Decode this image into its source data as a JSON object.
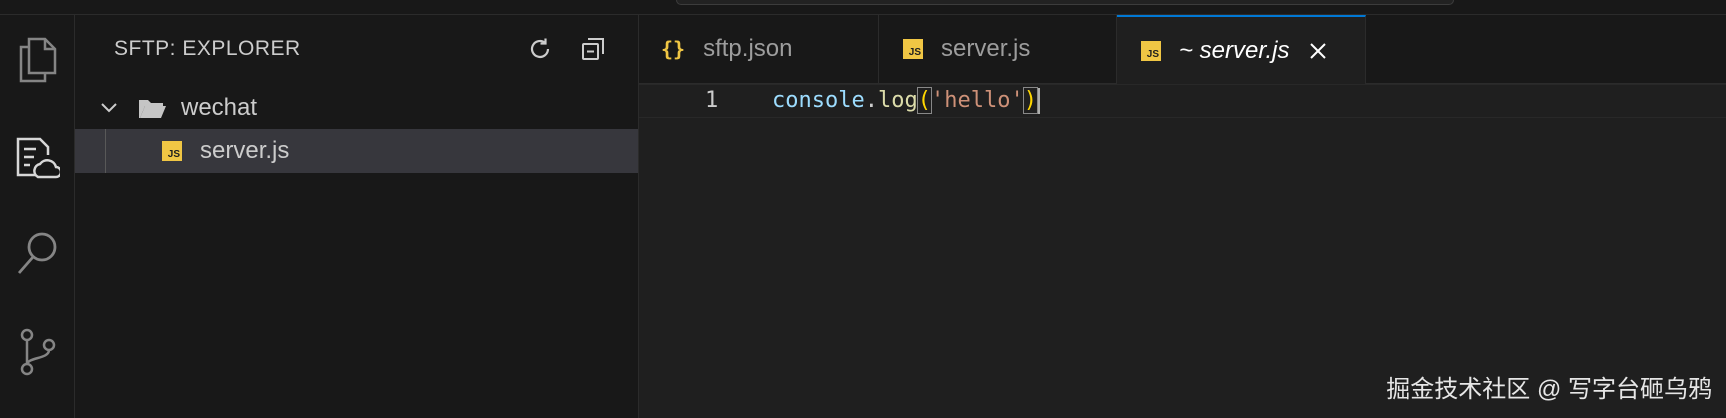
{
  "explorer": {
    "title": "SFTP: EXPLORER",
    "folder": {
      "name": "wechat",
      "expanded": true
    },
    "files": [
      {
        "name": "server.js",
        "icon": "js-file-icon",
        "selected": true
      }
    ]
  },
  "activity_bar": {
    "items": [
      {
        "name": "explorer-icon"
      },
      {
        "name": "sftp-remote-icon",
        "active": true
      },
      {
        "name": "search-icon"
      },
      {
        "name": "source-control-icon"
      }
    ]
  },
  "tabs": [
    {
      "label": "sftp.json",
      "icon": "json-braces-icon",
      "icon_text": "{}",
      "active": false
    },
    {
      "label": "server.js",
      "icon": "js-file-icon",
      "active": false
    },
    {
      "label": "~ server.js",
      "icon": "js-file-icon",
      "active": true,
      "closable": true
    }
  ],
  "editor": {
    "line_number": "1",
    "tokens": {
      "object": "console",
      "dot": ".",
      "method": "log",
      "open": "(",
      "string": "'hello'",
      "close": ")"
    }
  },
  "badge_text": "JS",
  "watermark": "掘金技术社区 @ 写字台砸乌鸦",
  "colors": {
    "accent": "#0078d4",
    "js_badge": "#f0c644",
    "string": "#ce9178",
    "function": "#dcdcaa",
    "variable": "#9cdcfe"
  }
}
